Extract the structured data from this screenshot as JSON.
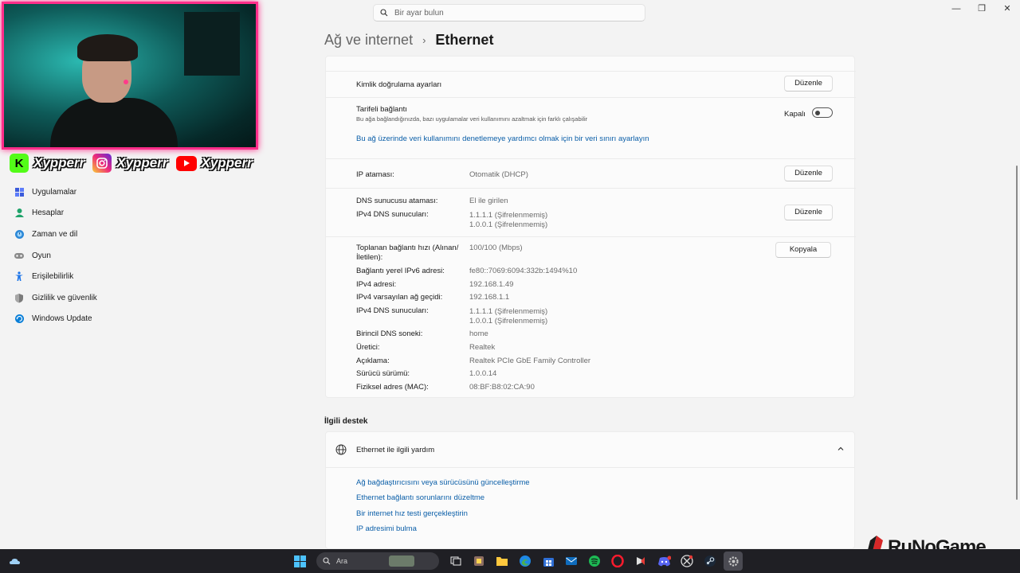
{
  "window": {
    "minimize": "—",
    "maximize": "❐",
    "close": "✕"
  },
  "search": {
    "placeholder": "Bir ayar bulun"
  },
  "breadcrumb": {
    "parent": "Ağ ve internet",
    "separator": "›",
    "current": "Ethernet"
  },
  "overlay": {
    "kick_name": "Xypperr",
    "instagram_name": "Xypperr",
    "youtube_name": "Xypperr"
  },
  "sidebar": {
    "items": [
      {
        "label": "Uygulamalar",
        "icon": "apps-icon",
        "color": "#3b5bdb"
      },
      {
        "label": "Hesaplar",
        "icon": "accounts-icon",
        "color": "#1fa36a"
      },
      {
        "label": "Zaman ve dil",
        "icon": "time-language-icon",
        "color": "#2b88d8"
      },
      {
        "label": "Oyun",
        "icon": "gaming-icon",
        "color": "#7a7a7a"
      },
      {
        "label": "Erişilebilirlik",
        "icon": "accessibility-icon",
        "color": "#1a73e8"
      },
      {
        "label": "Gizlilik ve güvenlik",
        "icon": "privacy-shield-icon",
        "color": "#6b6b6b"
      },
      {
        "label": "Windows Update",
        "icon": "windows-update-icon",
        "color": "#0a7fd8"
      }
    ]
  },
  "ethernet": {
    "auth": {
      "label": "Kimlik doğrulama ayarları",
      "button": "Düzenle"
    },
    "metered": {
      "label": "Tarifeli bağlantı",
      "description": "Bu ağa bağlandığınızda, bazı uygulamalar veri kullanımını azaltmak için farklı çalışabilir",
      "toggle_label": "Kapalı",
      "toggle_on": false
    },
    "data_limit_link": "Bu ağ üzerinde veri kullanımını denetlemeye yardımcı olmak için bir veri sınırı ayarlayın",
    "ip_assignment": {
      "label": "IP ataması:",
      "value": "Otomatik (DHCP)",
      "button": "Düzenle"
    },
    "dns_assignment": {
      "label": "DNS sunucusu ataması:",
      "value": "El ile girilen",
      "ipv4_label": "IPv4 DNS sunucuları:",
      "ipv4_values": [
        "1.1.1.1 (Şifrelenmemiş)",
        "1.0.0.1 (Şifrelenmemiş)"
      ],
      "button": "Düzenle"
    },
    "properties": {
      "copy_button": "Kopyala",
      "rows": [
        {
          "label": "Toplanan bağlantı hızı (Alınan/",
          "label2": "İletilen):",
          "value": "100/100 (Mbps)"
        },
        {
          "label": "Bağlantı yerel IPv6 adresi:",
          "value": "fe80::7069:6094:332b:1494%10"
        },
        {
          "label": "IPv4 adresi:",
          "value": "192.168.1.49"
        },
        {
          "label": "IPv4 varsayılan ağ geçidi:",
          "value": "192.168.1.1"
        },
        {
          "label": "IPv4 DNS sunucuları:",
          "value": "1.1.1.1 (Şifrelenmemiş)",
          "value2": "1.0.0.1 (Şifrelenmemiş)"
        },
        {
          "label": "Birincil DNS soneki:",
          "value": "home"
        },
        {
          "label": "Üretici:",
          "value": "Realtek"
        },
        {
          "label": "Açıklama:",
          "value": "Realtek PCIe GbE Family Controller"
        },
        {
          "label": "Sürücü sürümü:",
          "value": "1.0.0.14"
        },
        {
          "label": "Fiziksel adres (MAC):",
          "value": "08:BF:B8:02:CA:90"
        }
      ]
    }
  },
  "related": {
    "section_title": "İlgili destek",
    "help_header": "Ethernet ile ilgili yardım",
    "links": [
      "Ağ bağdaştırıcısını veya sürücüsünü güncelleştirme",
      "Ethernet bağlantı sorunlarını düzeltme",
      "Bir internet hız testi gerçekleştirin",
      "IP adresimi bulma"
    ]
  },
  "taskbar": {
    "search_label": "Ara"
  },
  "watermark": {
    "text": "RuNoGame"
  },
  "colors": {
    "accent": "#0a5ea8",
    "overlay_border": "#ff2e8a"
  }
}
